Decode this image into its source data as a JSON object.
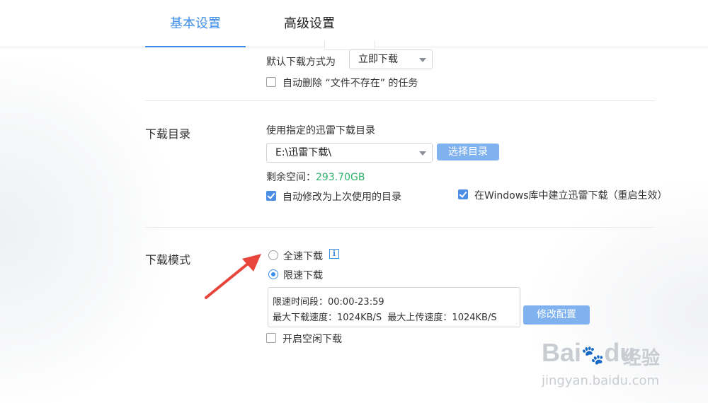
{
  "tabs": {
    "basic": "基本设置",
    "advanced": "高级设置"
  },
  "download_method": {
    "label": "默认下载方式为",
    "selected": "立即下载",
    "auto_delete_label": "自动删除 “文件不存在” 的任务",
    "auto_delete_checked": false
  },
  "download_dir": {
    "section_label": "下载目录",
    "use_specified_label": "使用指定的迅雷下载目录",
    "path": "E:\\迅雷下载\\",
    "choose_button": "选择目录",
    "free_space_label": "剩余空间：",
    "free_space_value": "293.70GB",
    "auto_modify_label": "自动修改为上次使用的目录",
    "auto_modify_checked": true,
    "windows_library_label": "在Windows库中建立迅雷下载（重启生效）",
    "windows_library_checked": true
  },
  "download_mode": {
    "section_label": "下载模式",
    "full_speed_label": "全速下载",
    "full_speed_selected": false,
    "info_icon": "info-icon",
    "limited_label": "限速下载",
    "limited_selected": true,
    "limit_period": "限速时间段：00:00-23:59",
    "limit_speeds": "最大下载速度：1024KB/S  最大上传速度：1024KB/S",
    "modify_button": "修改配置",
    "idle_download_label": "开启空闲下载",
    "idle_download_checked": false
  },
  "watermark": {
    "brand": "Bai",
    "brand_suffix": "du",
    "product": "经验",
    "url": "jingyan.baidu.com"
  },
  "colors": {
    "accent": "#3d8ee7",
    "button": "#7fb2ee",
    "free_space": "#2fb36b",
    "arrow": "#e8453c"
  }
}
